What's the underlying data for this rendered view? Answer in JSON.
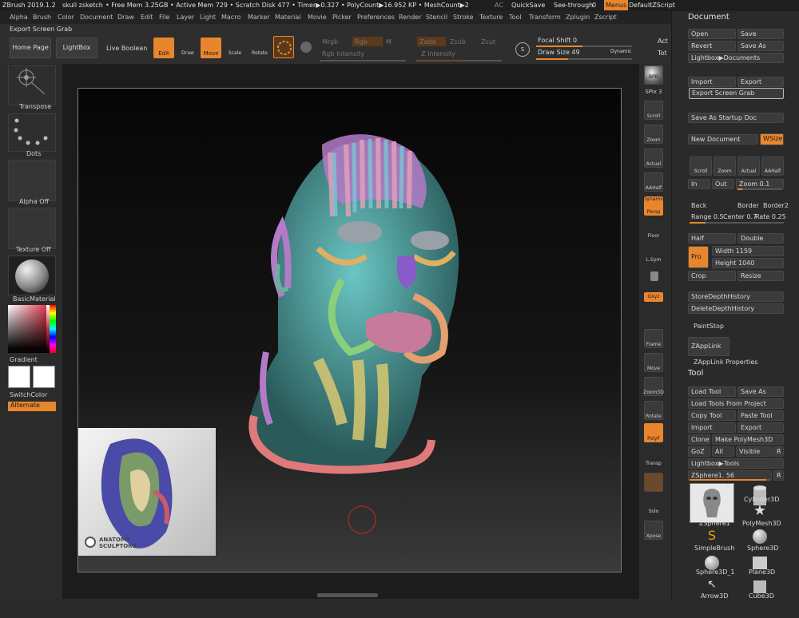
{
  "titlebar": {
    "app": "ZBrush 2019.1.2",
    "doc": "skull zsketch",
    "stats": "• Free Mem 3.25GB • Active Mem 729 • Scratch Disk 477 • Timer▶0.327 • PolyCount▶16.952 KP • MeshCount▶2",
    "ac": "AC",
    "quicksave": "QuickSave",
    "seethrough": "See-through",
    "seethrough_value": "0",
    "menus": "Menus",
    "defaultzscript": "DefaultZScript"
  },
  "menubar": [
    "Alpha",
    "Brush",
    "Color",
    "Document",
    "Draw",
    "Edit",
    "File",
    "Layer",
    "Light",
    "Macro",
    "Marker",
    "Material",
    "Movie",
    "Picker",
    "Preferences",
    "Render",
    "Stencil",
    "Stroke",
    "Texture",
    "Tool",
    "Transform",
    "Zplugin",
    "Zscript"
  ],
  "export_bar": "Export Screen Grab",
  "toolbar": {
    "home": "Home Page",
    "lightbox": "LightBox",
    "liveboolean": "Live Boolean",
    "edit": "Edit",
    "draw": "Draw",
    "move": "Move",
    "scale": "Scale",
    "rotate": "Rotate",
    "mrgb": "Mrgb",
    "rgb": "Rgb",
    "m": "M",
    "rgb_intensity": "Rgb Intensity",
    "zadd": "Zadd",
    "zsub": "Zsub",
    "zcut": "Zcut",
    "z_intensity": "Z Intensity",
    "focal_shift": "Focal Shift 0",
    "draw_size": "Draw Size 49",
    "dynamic": "Dynamic",
    "act": "Act",
    "tot": "Tot"
  },
  "leftpanel": {
    "transpose": "Transpose",
    "dots": "Dots",
    "alpha": "Alpha Off",
    "texture": "Texture Off",
    "material": "BasicMaterial",
    "gradient": "Gradient",
    "switchcolor": "SwitchColor",
    "alternate": "Alternate"
  },
  "inset": {
    "logo": "ANATOMY SCULPTORS"
  },
  "rightbar": {
    "bpr": "BPR",
    "spix": "SPix 3",
    "scroll": "Scroll",
    "zoom": "Zoom",
    "actual": "Actual",
    "aahalf": "AAHalf",
    "dynamic": "Dynamic",
    "persp": "Persp",
    "floor": "Floor",
    "lsym": "L.Sym",
    "xyz": "Qxyz",
    "frame": "Frame",
    "move": "Move",
    "zoom3d": "Zoom3D",
    "rotate": "Rotate",
    "polyf": "PolyF",
    "transp": "Transp",
    "ghost": "Ghost",
    "solo": "Solo",
    "xpose": "Xpose"
  },
  "document": {
    "title": "Document",
    "open": "Open",
    "save": "Save",
    "revert": "Revert",
    "saveas": "Save As",
    "lightbox_docs": "Lightbox▶Documents",
    "import": "Import",
    "export": "Export",
    "export_grab": "Export Screen Grab",
    "startup": "Save As Startup Doc",
    "newdoc": "New Document",
    "wsize": "WSize",
    "scroll": "Scroll",
    "zoom": "Zoom",
    "actual": "Actual",
    "aahalf": "AAHalf",
    "in": "In",
    "out": "Out",
    "zoomval": "Zoom 0.1",
    "back": "Back",
    "border": "Border",
    "border2": "Border2",
    "range": "Range 0.5",
    "center": "Center 0.7",
    "rate": "Rate 0.25",
    "half": "Half",
    "double": "Double",
    "pro": "Pro",
    "width": "Width 1159",
    "height": "Height 1040",
    "crop": "Crop",
    "resize": "Resize",
    "storedepth": "StoreDepthHistory",
    "deletedepth": "DeleteDepthHistory",
    "paintstop": "PaintStop",
    "zapplink": "ZAppLink",
    "zapplinkprops": "ZAppLink Properties"
  },
  "tool": {
    "title": "Tool",
    "loadtool": "Load Tool",
    "saveas": "Save As",
    "loadproject": "Load Tools From Project",
    "copytool": "Copy Tool",
    "pastetool": "Paste Tool",
    "import": "Import",
    "export": "Export",
    "clone": "Clone",
    "makepoly": "Make PolyMesh3D",
    "goz": "GoZ",
    "all": "All",
    "visible": "Visible",
    "r": "R",
    "lightbox_tools": "Lightbox▶Tools",
    "zsphere_slider": "ZSphere1. 56",
    "count": "5",
    "items": [
      "ZSphere1",
      "Cylinder3D",
      "PolyMesh3D",
      "SimpleBrush",
      "Sphere3D",
      "Sphere3D_1",
      "Plane3D",
      "Arrow3D",
      "Cube3D"
    ]
  },
  "colors": {
    "accent": "#e8862e",
    "bg": "#2a2a2a"
  }
}
